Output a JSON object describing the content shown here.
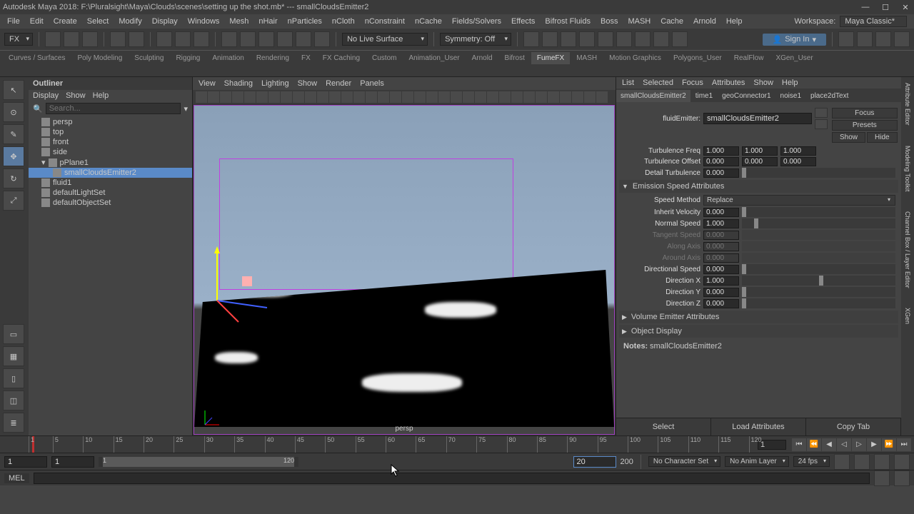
{
  "title": "Autodesk Maya 2018: F:\\Pluralsight\\Maya\\Clouds\\scenes\\setting up the shot.mb*  ---  smallCloudsEmitter2",
  "menus": [
    "File",
    "Edit",
    "Create",
    "Select",
    "Modify",
    "Display",
    "Windows",
    "Mesh",
    "nHair",
    "nParticles",
    "nCloth",
    "nConstraint",
    "nCache",
    "Fields/Solvers",
    "Effects",
    "Bifrost Fluids",
    "Boss",
    "MASH",
    "Cache",
    "Arnold",
    "Help"
  ],
  "workspace": {
    "label": "Workspace:",
    "value": "Maya Classic*"
  },
  "fx_dropdown": "FX",
  "no_live": "No Live Surface",
  "symmetry": "Symmetry: Off",
  "sign_in": "Sign In",
  "shelf_tabs": [
    "Curves / Surfaces",
    "Poly Modeling",
    "Sculpting",
    "Rigging",
    "Animation",
    "Rendering",
    "FX",
    "FX Caching",
    "Custom",
    "Animation_User",
    "Arnold",
    "Bifrost",
    "FumeFX",
    "MASH",
    "Motion Graphics",
    "Polygons_User",
    "RealFlow",
    "XGen_User"
  ],
  "shelf_active": 12,
  "outliner": {
    "title": "Outliner",
    "menus": [
      "Display",
      "Show",
      "Help"
    ],
    "search": "Search...",
    "items": [
      {
        "name": "persp",
        "indent": 0
      },
      {
        "name": "top",
        "indent": 0
      },
      {
        "name": "front",
        "indent": 0
      },
      {
        "name": "side",
        "indent": 0
      },
      {
        "name": "pPlane1",
        "indent": 0,
        "exp": true,
        "sel": false
      },
      {
        "name": "smallCloudsEmitter2",
        "indent": 1,
        "sel": true
      },
      {
        "name": "fluid1",
        "indent": 0
      },
      {
        "name": "defaultLightSet",
        "indent": 0
      },
      {
        "name": "defaultObjectSet",
        "indent": 0
      }
    ]
  },
  "viewport": {
    "menus": [
      "View",
      "Shading",
      "Lighting",
      "Show",
      "Render",
      "Panels"
    ],
    "name": "persp"
  },
  "attr": {
    "menus": [
      "List",
      "Selected",
      "Focus",
      "Attributes",
      "Show",
      "Help"
    ],
    "tabs": [
      "smallCloudsEmitter2",
      "time1",
      "geoConnector1",
      "noise1",
      "place2dText"
    ],
    "node_label": "fluidEmitter:",
    "node_name": "smallCloudsEmitter2",
    "side_btns": [
      "Focus",
      "Presets",
      "Show",
      "Hide"
    ],
    "rows_top": [
      {
        "label": "Turbulence Freq",
        "v": [
          "1.000",
          "1.000",
          "1.000"
        ]
      },
      {
        "label": "Turbulence Offset",
        "v": [
          "0.000",
          "0.000",
          "0.000"
        ]
      },
      {
        "label": "Detail Turbulence",
        "v": [
          "0.000"
        ],
        "slider": 0
      }
    ],
    "section1": "Emission Speed Attributes",
    "speed_method": {
      "label": "Speed Method",
      "value": "Replace"
    },
    "rows_mid": [
      {
        "label": "Inherit Velocity",
        "v": "0.000",
        "slider": 0
      },
      {
        "label": "Normal Speed",
        "v": "1.000",
        "slider": 8
      },
      {
        "label": "Tangent Speed",
        "v": "0.000",
        "dis": true
      },
      {
        "label": "Along Axis",
        "v": "0.000",
        "dis": true
      },
      {
        "label": "Around Axis",
        "v": "0.000",
        "dis": true
      },
      {
        "label": "Directional Speed",
        "v": "0.000",
        "slider": 0
      },
      {
        "label": "Direction X",
        "v": "1.000",
        "slider": 50
      },
      {
        "label": "Direction Y",
        "v": "0.000",
        "slider": 0
      },
      {
        "label": "Direction Z",
        "v": "0.000",
        "slider": 0
      }
    ],
    "section2": "Volume Emitter Attributes",
    "section3": "Object Display",
    "notes_label": "Notes:",
    "notes_value": "smallCloudsEmitter2",
    "bottom_btns": [
      "Select",
      "Load Attributes",
      "Copy Tab"
    ]
  },
  "right_tabs": [
    "Attribute Editor",
    "Modeling Toolkit",
    "Channel Box / Layer Editor",
    "XGen"
  ],
  "timeline": {
    "ticks": [
      1,
      5,
      10,
      15,
      20,
      25,
      30,
      35,
      40,
      45,
      50,
      55,
      60,
      65,
      70,
      75,
      80,
      85,
      90,
      95,
      100,
      105,
      110,
      115,
      120
    ],
    "current": 1,
    "frame_field": "1"
  },
  "range": {
    "start_outer": "1",
    "start_inner": "1",
    "slider_start": "1",
    "slider_end": "120",
    "end_input": "20",
    "end_outer": "200",
    "char_set": "No Character Set",
    "anim_layer": "No Anim Layer",
    "fps": "24 fps"
  },
  "cmd": {
    "lang": "MEL"
  }
}
